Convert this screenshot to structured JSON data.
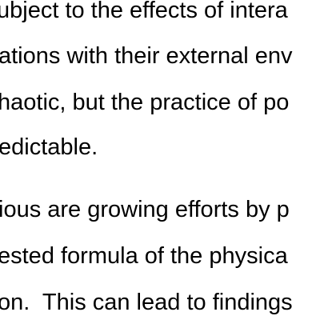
{
  "document": {
    "paragraph_1": {
      "line_1": "ubject to the effects of intera",
      "line_2": "ations with their external env",
      "line_3": "haotic, but the practice of po",
      "line_4": "edictable."
    },
    "paragraph_2": {
      "line_1": "ious are growing efforts by p",
      "line_2": "ested formula of the physica",
      "line_3": "on.  This can lead to findings"
    }
  }
}
